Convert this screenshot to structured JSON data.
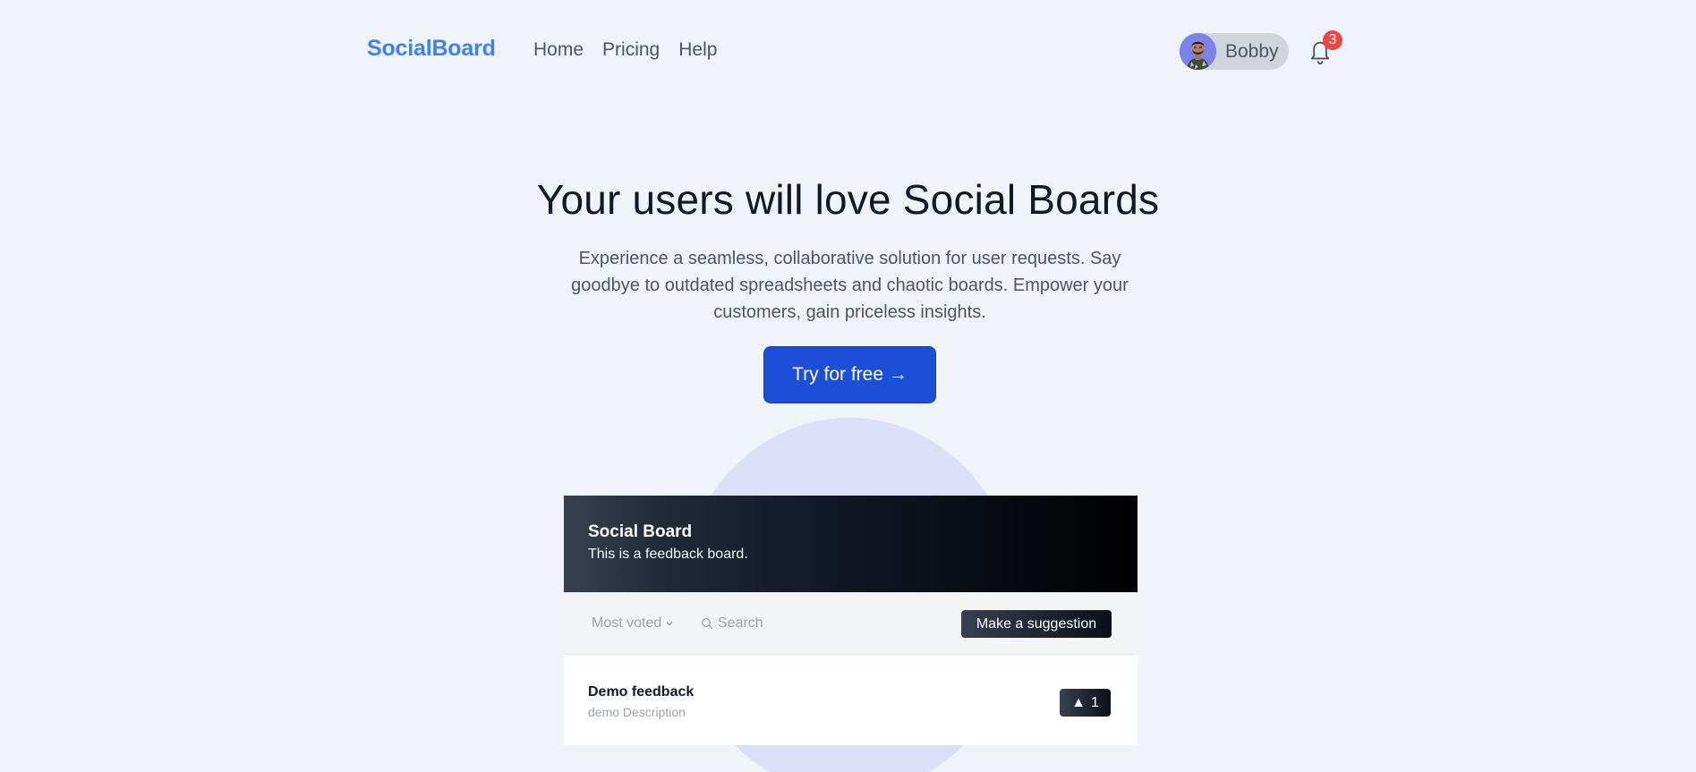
{
  "nav": {
    "logo": "SocialBoard",
    "links": [
      {
        "label": "Home"
      },
      {
        "label": "Pricing"
      },
      {
        "label": "Help"
      }
    ],
    "user": {
      "name": "Bobby"
    },
    "notifications": {
      "count": "3"
    }
  },
  "hero": {
    "title": "Your users will love Social Boards",
    "subtitle": "Experience a seamless, collaborative solution for user requests. Say goodbye to outdated spreadsheets and chaotic boards. Empower your customers, gain priceless insights.",
    "cta_label": "Try for free →"
  },
  "board": {
    "title": "Social Board",
    "description": "This is a feedback board.",
    "sort_label": "Most voted",
    "search_placeholder": "Search",
    "suggest_label": "Make a suggestion",
    "items": [
      {
        "title": "Demo feedback",
        "description": "demo Description",
        "vote_icon": "▲",
        "votes": "1"
      }
    ]
  },
  "colors": {
    "brand": "#3b82f6",
    "cta": "#1d4ed8",
    "badge": "#ef4444",
    "blob": "#dbe0f8"
  },
  "icons": [
    "bell-icon",
    "chevron-down-icon",
    "search-icon",
    "upvote-icon",
    "avatar"
  ]
}
